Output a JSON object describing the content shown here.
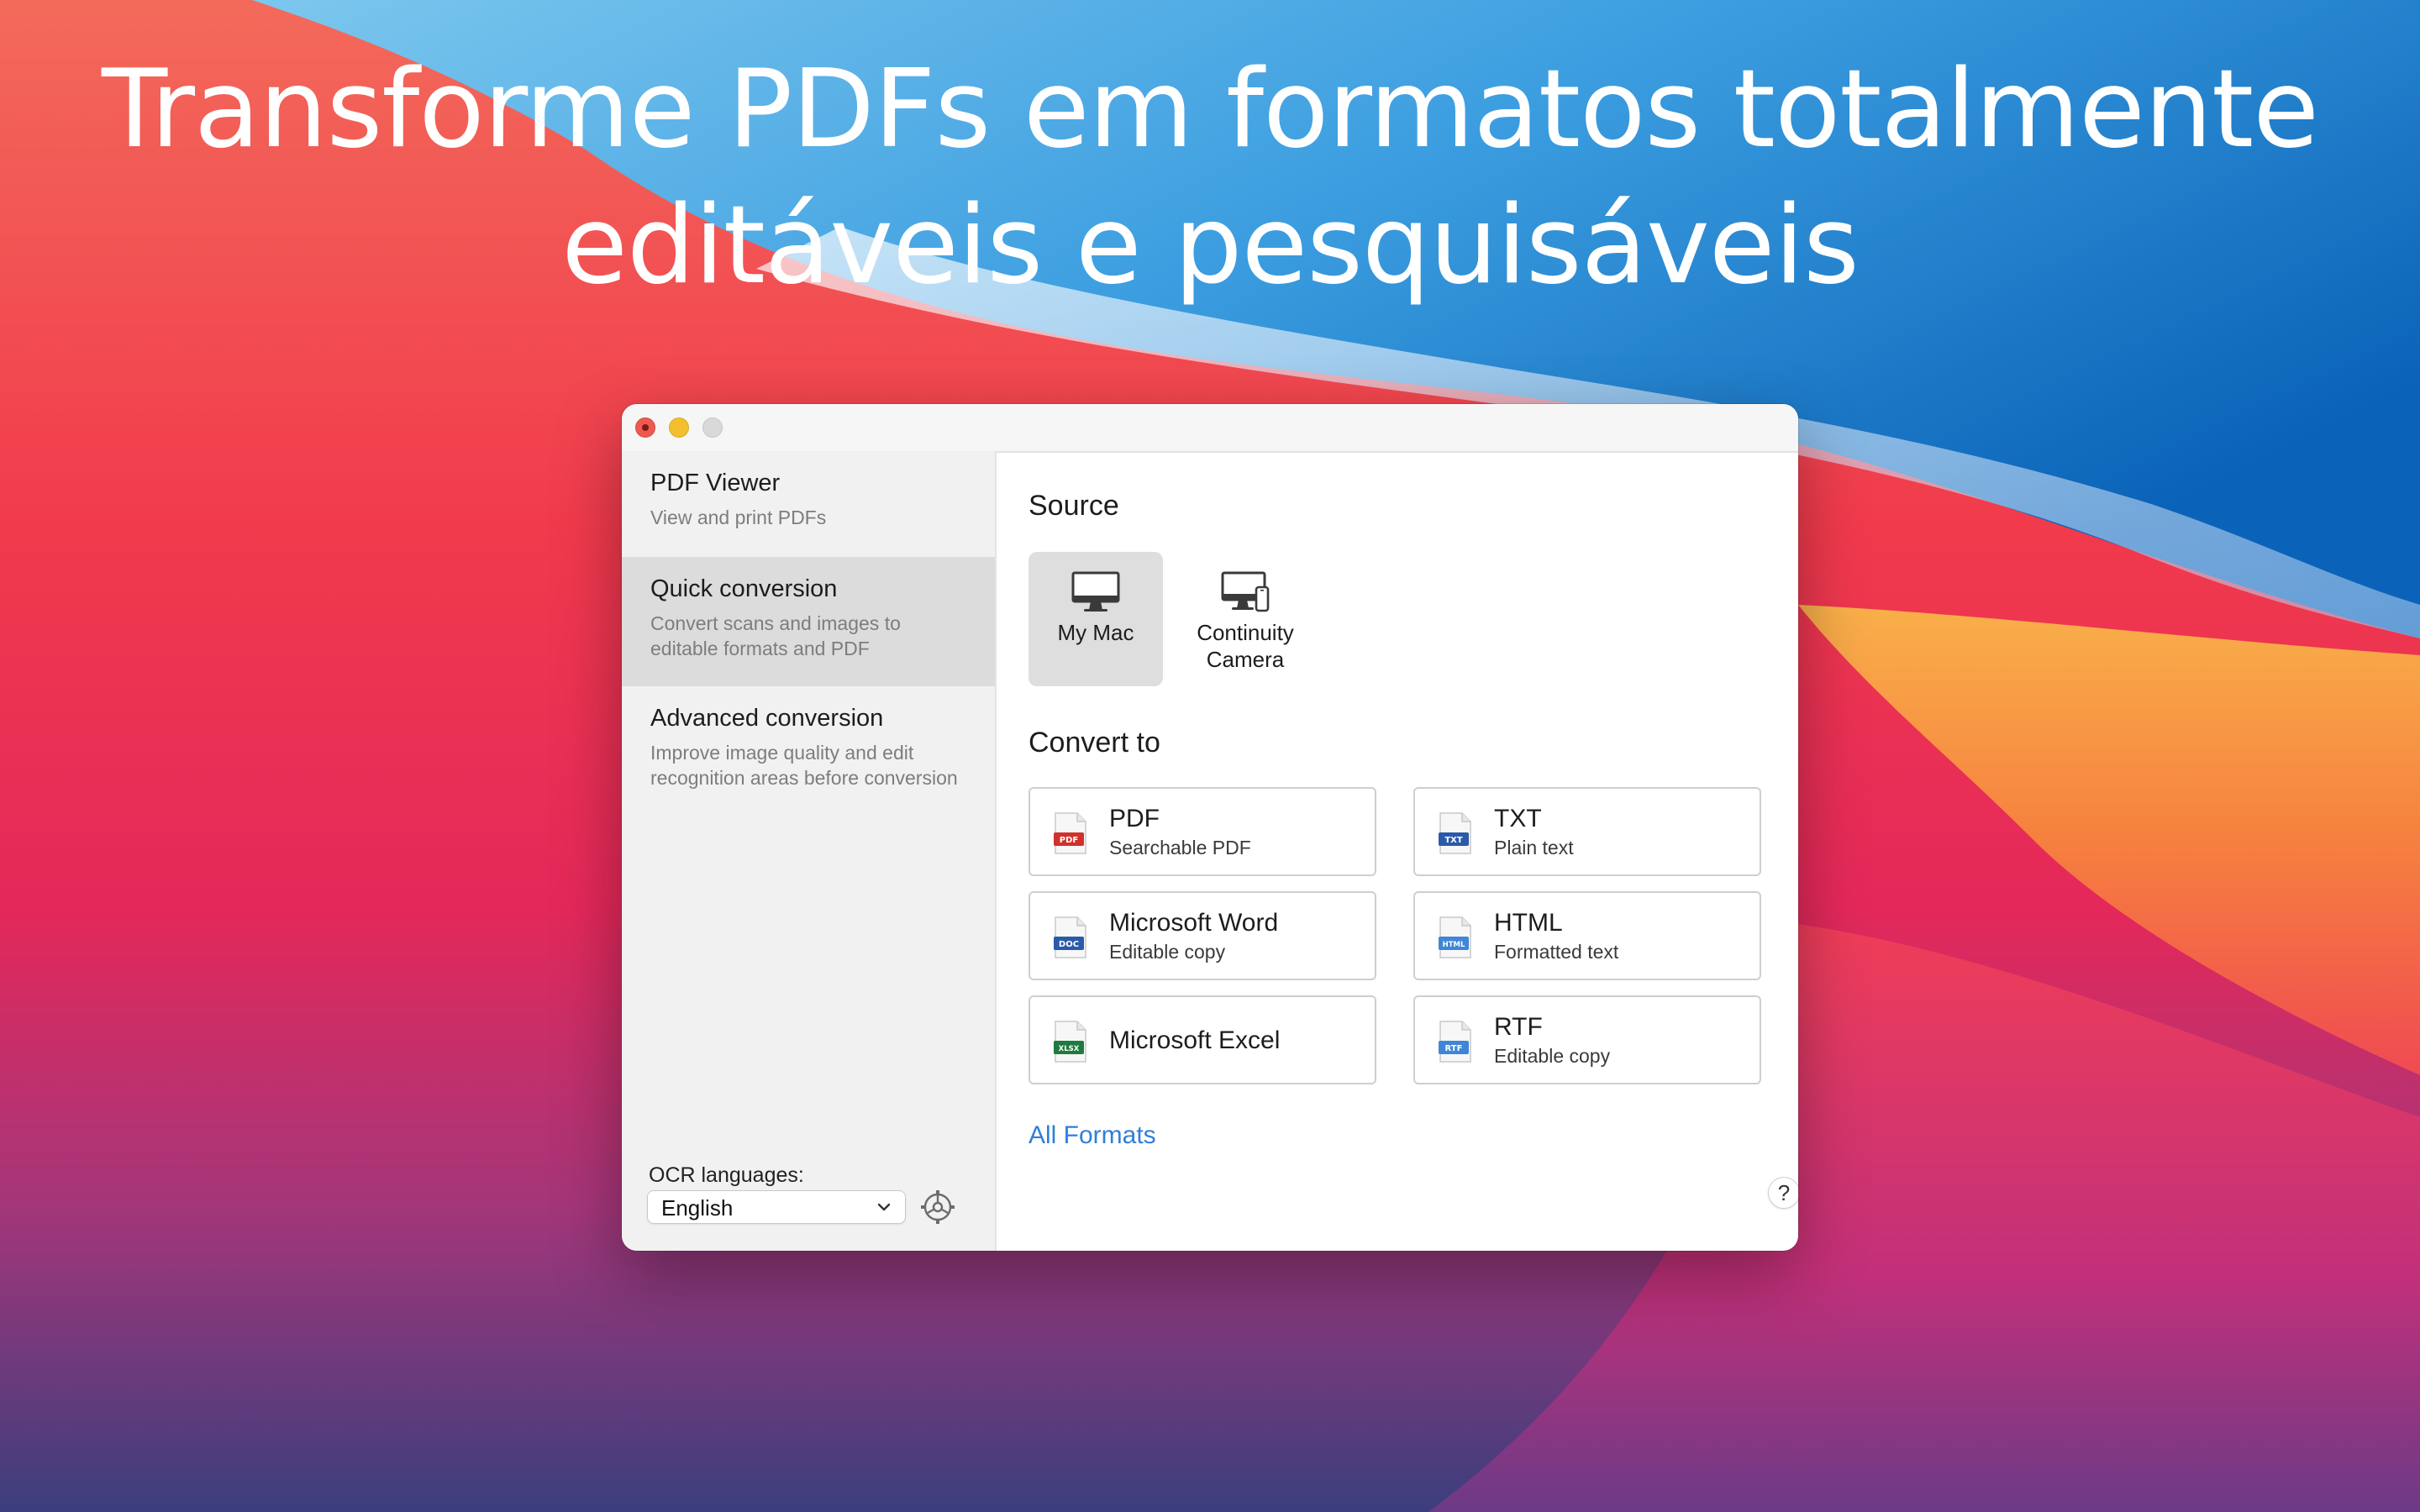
{
  "headline": {
    "line1": "Transforme PDFs em formatos totalmente",
    "line2": "editáveis e pesquisáveis"
  },
  "sidebar": {
    "items": [
      {
        "title": "PDF Viewer",
        "desc": "View and print PDFs",
        "selected": false
      },
      {
        "title": "Quick conversion",
        "desc": "Convert scans and images to editable formats and PDF",
        "selected": true
      },
      {
        "title": "Advanced conversion",
        "desc": "Improve image quality and edit recognition areas before conversion",
        "selected": false
      }
    ],
    "ocr_label": "OCR languages:",
    "ocr_value": "English"
  },
  "main": {
    "source_heading": "Source",
    "sources": [
      {
        "label": "My Mac",
        "icon": "monitor-icon",
        "selected": true
      },
      {
        "label": "Continuity Camera",
        "icon": "continuity-camera-icon",
        "selected": false
      }
    ],
    "convert_heading": "Convert to",
    "formats": [
      {
        "title": "PDF",
        "subtitle": "Searchable PDF",
        "badge": "PDF",
        "color": "#d0312d"
      },
      {
        "title": "TXT",
        "subtitle": "Plain text",
        "badge": "TXT",
        "color": "#2b5aa8"
      },
      {
        "title": "Microsoft Word",
        "subtitle": "Editable copy",
        "badge": "DOC",
        "color": "#2b5aa8"
      },
      {
        "title": "HTML",
        "subtitle": "Formatted text",
        "badge": "HTML",
        "color": "#3f86d6"
      },
      {
        "title": "Microsoft Excel",
        "subtitle": "",
        "badge": "XLSX",
        "color": "#1f7a3f"
      },
      {
        "title": "RTF",
        "subtitle": "Editable copy",
        "badge": "RTF",
        "color": "#3f86d6"
      }
    ],
    "all_formats_link": "All Formats",
    "help_label": "?"
  },
  "colors": {
    "accent_link": "#2f7fd9",
    "selected_bg": "#dcdcdc"
  }
}
